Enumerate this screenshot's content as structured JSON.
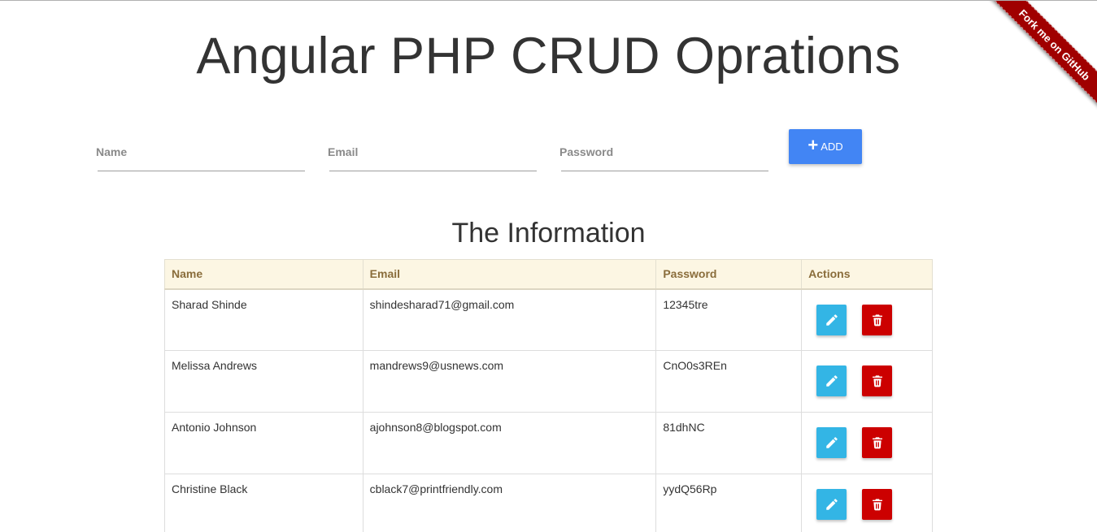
{
  "page": {
    "title": "Angular PHP CRUD Oprations",
    "ribbon_label": "Fork me on GitHub",
    "subtitle": "The Information"
  },
  "form": {
    "name_placeholder": "Name",
    "email_placeholder": "Email",
    "password_placeholder": "Password",
    "add_label": "ADD"
  },
  "table": {
    "columns": [
      "Name",
      "Email",
      "Password",
      "Actions"
    ],
    "rows": [
      {
        "name": "Sharad Shinde",
        "email": "shindesharad71@gmail.com",
        "password": "12345tre"
      },
      {
        "name": "Melissa Andrews",
        "email": "mandrews9@usnews.com",
        "password": "CnO0s3REn"
      },
      {
        "name": "Antonio Johnson",
        "email": "ajohnson8@blogspot.com",
        "password": "81dhNC"
      },
      {
        "name": "Christine Black",
        "email": "cblack7@printfriendly.com",
        "password": "yydQ56Rp"
      }
    ]
  },
  "icons": {
    "add": "plus-icon",
    "edit": "pencil-icon",
    "delete": "trash-icon"
  },
  "colors": {
    "add_button": "#4285f4",
    "edit_button": "#33b5e5",
    "delete_button": "#cc0000",
    "ribbon": "#a00000",
    "table_header_bg": "#fcf6e3",
    "table_header_text": "#8a6d3b"
  }
}
